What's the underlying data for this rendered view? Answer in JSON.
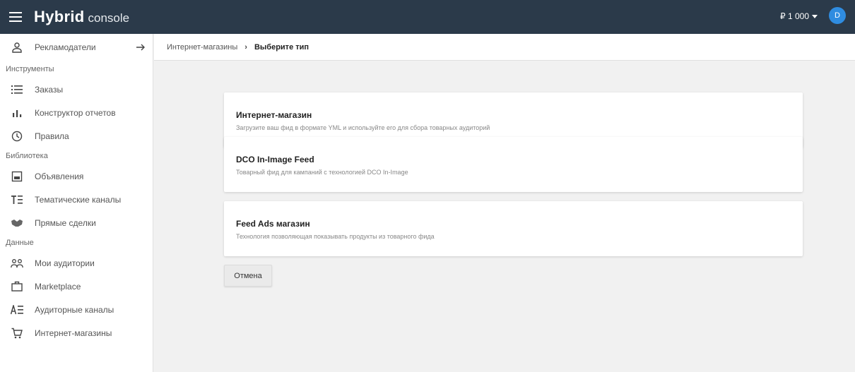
{
  "app": {
    "logo_main": "Hybrid",
    "logo_sub": "console"
  },
  "header": {
    "balance": "₽ 1 000",
    "avatar_initial": "D"
  },
  "sidebar": {
    "advertisers_label": "Рекламодатели",
    "sections": {
      "tools": "Инструменты",
      "library": "Библиотека",
      "data": "Данные"
    },
    "items": [
      {
        "label": "Заказы",
        "icon": "list-icon"
      },
      {
        "label": "Конструктор отчетов",
        "icon": "bar-chart-icon"
      },
      {
        "label": "Правила",
        "icon": "clock-icon"
      },
      {
        "label": "Объявления",
        "icon": "image-icon"
      },
      {
        "label": "Тематические каналы",
        "icon": "text-list-icon"
      },
      {
        "label": "Прямые сделки",
        "icon": "handshake-icon"
      },
      {
        "label": "Мои аудитории",
        "icon": "people-icon"
      },
      {
        "label": "Marketplace",
        "icon": "briefcase-icon"
      },
      {
        "label": "Аудиторные каналы",
        "icon": "text-format-icon"
      },
      {
        "label": "Интернет-магазины",
        "icon": "cart-icon"
      }
    ]
  },
  "breadcrumb": {
    "parent": "Интернет-магазины",
    "separator": "›",
    "current": "Выберите тип"
  },
  "cards": [
    {
      "title": "Интернет-магазин",
      "description": "Загрузите ваш фид в формате YML и используйте его для сбора товарных аудиторий"
    },
    {
      "title": "DCO In-Image Feed",
      "description": "Товарный фид для кампаний с технологией DCO In-Image"
    },
    {
      "title": "Feed Ads магазин",
      "description": "Технология позволяющая показывать продукты из товарного фида"
    }
  ],
  "actions": {
    "cancel_label": "Отмена"
  },
  "colors": {
    "topbar": "#2b3a4a",
    "accent": "#2f8ce0",
    "background": "#f1f1f1"
  }
}
